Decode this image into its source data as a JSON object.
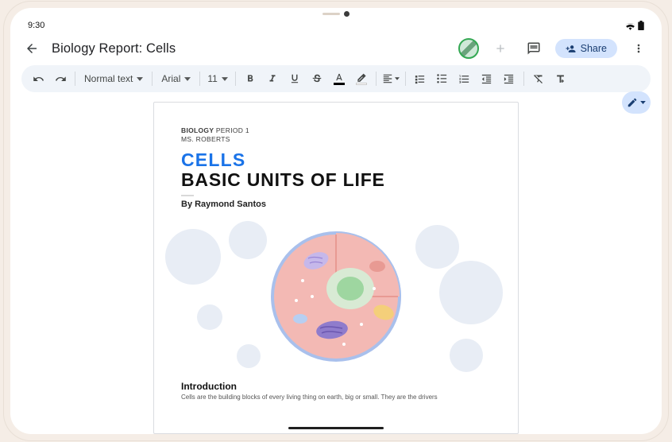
{
  "status": {
    "time": "9:30"
  },
  "header": {
    "doc_title": "Biology Report: Cells",
    "share_label": "Share"
  },
  "toolbar": {
    "style_select": "Normal text",
    "font_select": "Arial",
    "font_size": "11"
  },
  "document": {
    "eyebrow_bold": "BIOLOGY",
    "eyebrow_rest": "PERIOD 1",
    "eyebrow_line2": "MS. ROBERTS",
    "title_a": "CELLS",
    "title_b": "BASIC UNITS OF LIFE",
    "byline": "By Raymond Santos",
    "section1_h": "Introduction",
    "section1_body": "Cells are the building blocks of every living thing on earth, big or small. They are the drivers"
  }
}
